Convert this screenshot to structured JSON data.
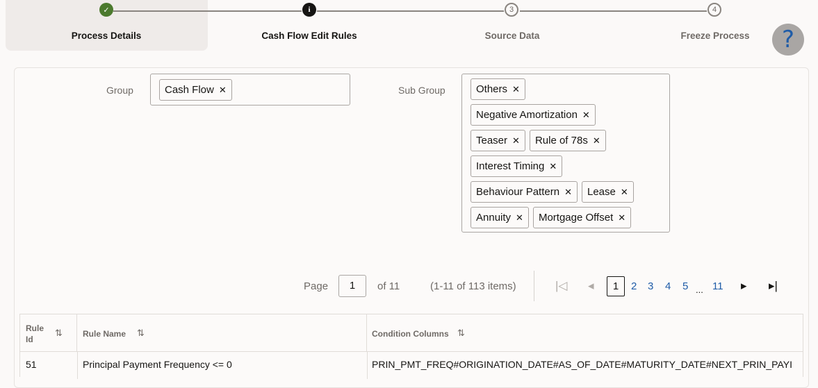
{
  "train": {
    "steps": [
      {
        "label": "Process Details",
        "status": "done",
        "icon": "check-icon",
        "glyph": "✓"
      },
      {
        "label": "Cash Flow Edit Rules",
        "status": "current",
        "icon": "info-icon",
        "glyph": "i"
      },
      {
        "label": "Source Data",
        "status": "todo",
        "number": "3"
      },
      {
        "label": "Freeze Process",
        "status": "todo",
        "number": "4"
      }
    ],
    "help_glyph": "?"
  },
  "filters": {
    "group_label": "Group",
    "group_values": [
      "Cash Flow"
    ],
    "subgroup_label": "Sub Group",
    "subgroup_values": [
      "Others",
      "Negative Amortization",
      "Teaser",
      "Rule of 78s",
      "Interest Timing",
      "Behaviour Pattern",
      "Lease",
      "Annuity",
      "Mortgage Offset"
    ],
    "remove_glyph": "✕"
  },
  "pagination": {
    "page_label": "Page",
    "current_page": "1",
    "of_label": "of 11",
    "range_text": "(1-11 of 113 items)",
    "pages": [
      "1",
      "2",
      "3",
      "4",
      "5",
      "11"
    ],
    "ellipsis": "...",
    "first_glyph": "|◁",
    "prev_glyph": "◂",
    "next_glyph": "▸",
    "last_glyph": "▸|"
  },
  "table": {
    "columns": [
      {
        "label_line1": "Rule",
        "label_line2": "Id"
      },
      {
        "label": "Rule Name"
      },
      {
        "label": "Condition Columns"
      }
    ],
    "sort_glyph": "⇅",
    "rows": [
      {
        "rule_id": "51",
        "rule_name": "Principal Payment Frequency <= 0",
        "condition_columns": "PRIN_PMT_FREQ#ORIGINATION_DATE#AS_OF_DATE#MATURITY_DATE#NEXT_PRIN_PAYI"
      }
    ]
  },
  "colors": {
    "done": "#4c7a2e",
    "current": "#161513",
    "link": "#1f5ca8"
  }
}
